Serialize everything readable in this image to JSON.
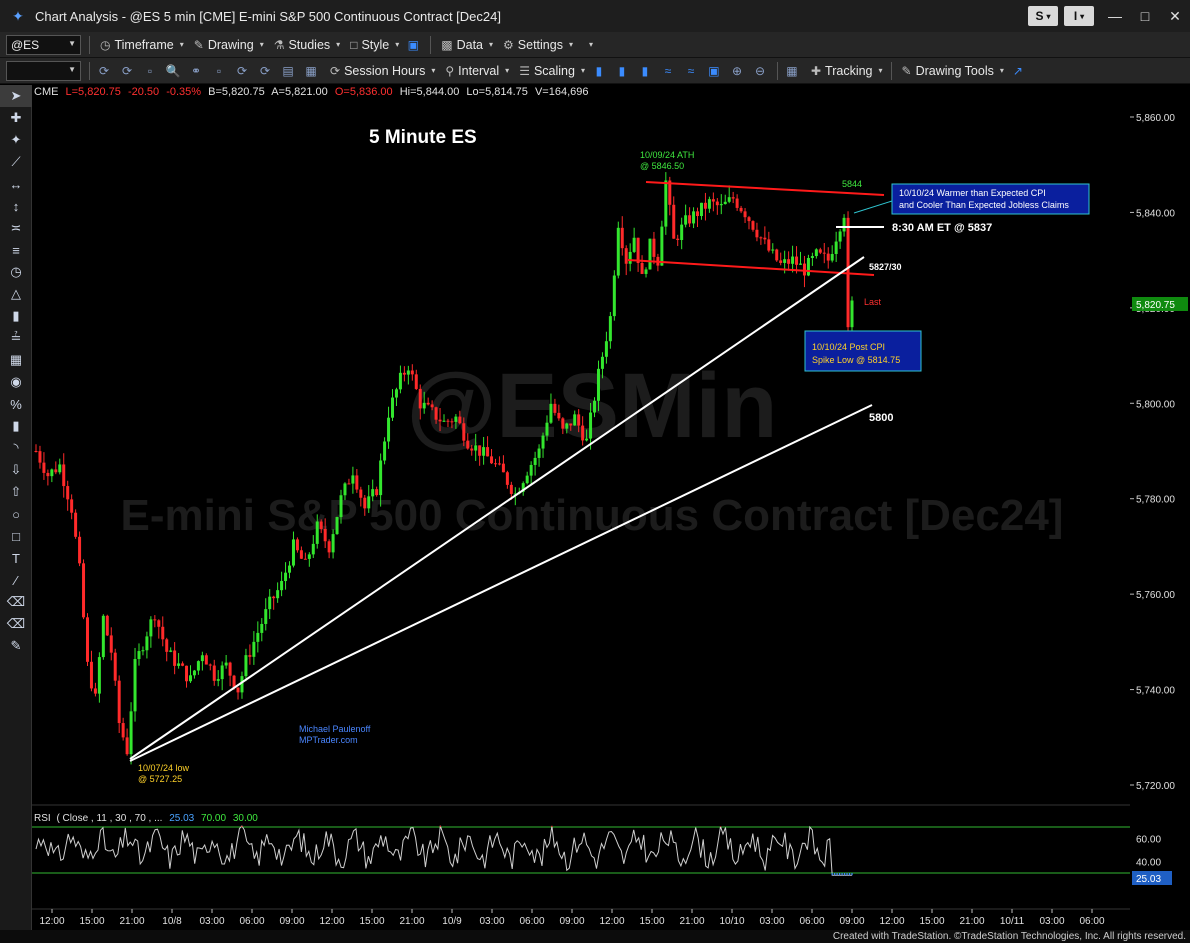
{
  "window": {
    "title": "Chart Analysis - @ES 5 min [CME] E-mini S&P 500 Continuous Contract [Dec24]",
    "s_button": "S",
    "i_button": "I"
  },
  "toolbar1": {
    "symbol": "@ES",
    "timeframe": "Timeframe",
    "drawing": "Drawing",
    "studies": "Studies",
    "style": "Style",
    "data": "Data",
    "settings": "Settings"
  },
  "toolbar2": {
    "session_hours": "Session Hours",
    "interval": "Interval",
    "scaling": "Scaling",
    "tracking": "Tracking",
    "drawing_tools": "Drawing Tools"
  },
  "quote": {
    "exchange": "CME",
    "last": "L=5,820.75",
    "change": "-20.50",
    "pct": "-0.35%",
    "bid": "B=5,820.75",
    "ask": "A=5,821.00",
    "open": "O=5,836.00",
    "hi": "Hi=5,844.00",
    "lo": "Lo=5,814.75",
    "vol": "V=164,696"
  },
  "watermark": {
    "symbol": "@ESMin",
    "description": "E-mini S&P 500 Continuous Contract [Dec24]"
  },
  "annotations": {
    "heading": "5 Minute ES",
    "ath": "10/09/24 ATH",
    "ath_price": "@ 5846.50",
    "cpi_note1": "10/10/24 Warmer than Expected CPI",
    "cpi_note2": "and Cooler Than Expected Jobless Claims",
    "label_5844": "5844",
    "label_837": "8:30 AM ET @ 5837",
    "label_5827": "5827/30",
    "label_last": "Last",
    "spike1": "10/10/24 Post CPI",
    "spike2": "Spike Low @ 5814.75",
    "label_5800": "5800",
    "author1": "Michael Paulenoff",
    "author2": "MPTrader.com",
    "low1": "10/07/24 low",
    "low2": "@ 5727.25"
  },
  "price_axis": {
    "labels": [
      "5,860.00",
      "5,840.00",
      "5,820.00",
      "5,800.00",
      "5,780.00",
      "5,760.00",
      "5,740.00",
      "5,720.00"
    ],
    "values": [
      5860,
      5840,
      5820,
      5800,
      5780,
      5760,
      5740,
      5720
    ],
    "last_label": "5,820.75",
    "last_value": 5820.75
  },
  "rsi": {
    "label": "RSI",
    "params": "( Close , 11 , 30 , 70 , ...",
    "value": "25.03",
    "overbought": "70.00",
    "oversold": "30.00",
    "axis_labels": [
      "60.00",
      "40.00"
    ],
    "axis_values": [
      60,
      40
    ]
  },
  "time_axis": {
    "labels": [
      "12:00",
      "15:00",
      "21:00",
      "10/8",
      "03:00",
      "06:00",
      "09:00",
      "12:00",
      "15:00",
      "21:00",
      "10/9",
      "03:00",
      "06:00",
      "09:00",
      "12:00",
      "15:00",
      "21:00",
      "10/10",
      "03:00",
      "06:00",
      "09:00",
      "12:00",
      "15:00",
      "21:00",
      "10/11",
      "03:00",
      "06:00"
    ]
  },
  "footer": "Created with TradeStation. ©TradeStation Technologies, Inc. All rights reserved.",
  "colors": {
    "up": "#33e62e",
    "down": "#ff2a2a",
    "trend_red": "#ff1a1a",
    "trend_white": "#ffffff",
    "note_blue": "#0a1f9e",
    "label_yellow": "#ffd22a",
    "label_green": "#3fe83f",
    "rsi_line": "#cfcfcf"
  },
  "chart_data": {
    "type": "candlestick",
    "title": "5 Minute ES",
    "ylim": [
      5716,
      5868
    ],
    "path": [
      [
        0,
        5790
      ],
      [
        3,
        5785
      ],
      [
        6,
        5787
      ],
      [
        9,
        5778
      ],
      [
        11,
        5765
      ],
      [
        13,
        5745
      ],
      [
        15,
        5738
      ],
      [
        17,
        5755
      ],
      [
        19,
        5748
      ],
      [
        21,
        5733
      ],
      [
        23,
        5727.25
      ],
      [
        25,
        5745
      ],
      [
        28,
        5752
      ],
      [
        30,
        5756
      ],
      [
        33,
        5748
      ],
      [
        36,
        5745
      ],
      [
        39,
        5742
      ],
      [
        42,
        5748
      ],
      [
        45,
        5743
      ],
      [
        48,
        5745
      ],
      [
        51,
        5740
      ],
      [
        53,
        5746
      ],
      [
        56,
        5752
      ],
      [
        59,
        5758
      ],
      [
        62,
        5762
      ],
      [
        65,
        5770
      ],
      [
        68,
        5766
      ],
      [
        71,
        5774
      ],
      [
        74,
        5770
      ],
      [
        77,
        5780
      ],
      [
        80,
        5786
      ],
      [
        83,
        5778
      ],
      [
        86,
        5782
      ],
      [
        89,
        5798
      ],
      [
        92,
        5805
      ],
      [
        94,
        5808
      ],
      [
        97,
        5800
      ],
      [
        100,
        5798
      ],
      [
        103,
        5796
      ],
      [
        106,
        5797
      ],
      [
        109,
        5792
      ],
      [
        112,
        5790
      ],
      [
        115,
        5788
      ],
      [
        118,
        5785
      ],
      [
        121,
        5781
      ],
      [
        124,
        5786
      ],
      [
        127,
        5790
      ],
      [
        130,
        5800
      ],
      [
        133,
        5794
      ],
      [
        136,
        5797
      ],
      [
        139,
        5792
      ],
      [
        142,
        5806
      ],
      [
        145,
        5818
      ],
      [
        147,
        5838
      ],
      [
        149,
        5830
      ],
      [
        151,
        5835
      ],
      [
        153,
        5826
      ],
      [
        155,
        5833
      ],
      [
        157,
        5830
      ],
      [
        159,
        5846.5
      ],
      [
        161,
        5834
      ],
      [
        164,
        5838
      ],
      [
        167,
        5840
      ],
      [
        170,
        5842
      ],
      [
        173,
        5841
      ],
      [
        176,
        5843
      ],
      [
        179,
        5840
      ],
      [
        182,
        5836
      ],
      [
        185,
        5832
      ],
      [
        188,
        5829
      ],
      [
        191,
        5830
      ],
      [
        194,
        5828
      ],
      [
        197,
        5831
      ],
      [
        200,
        5830
      ],
      [
        202,
        5835
      ],
      [
        204,
        5840
      ],
      [
        205,
        5814.75
      ],
      [
        206,
        5820.75
      ]
    ],
    "bars": 207
  }
}
